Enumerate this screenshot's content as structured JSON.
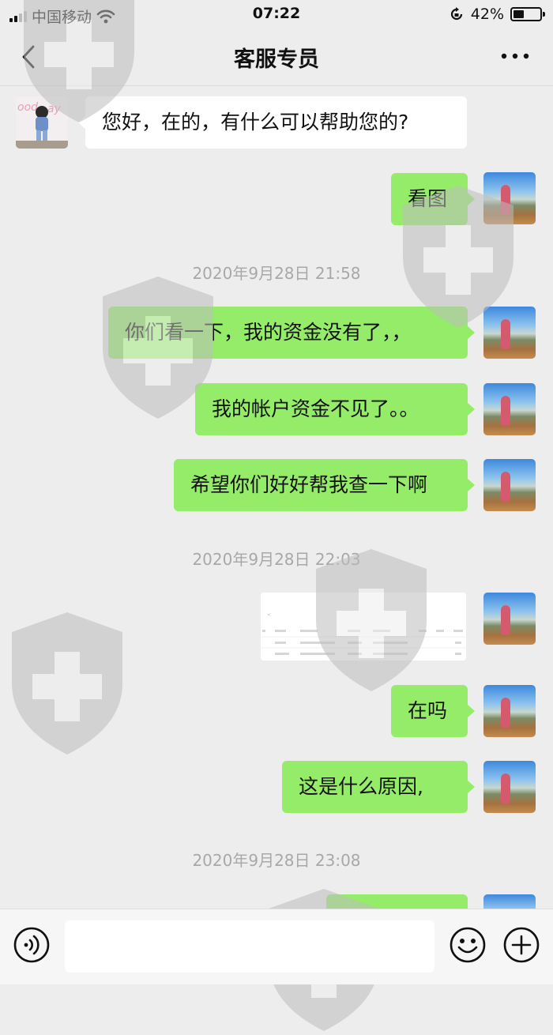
{
  "status_bar": {
    "carrier": "中国移动",
    "time": "07:22",
    "battery_percent": "42%",
    "battery_level": 0.42
  },
  "header": {
    "title": "客服专员"
  },
  "messages": [
    {
      "from": "agent",
      "text": "您好，在的，有什么可以帮助您的?"
    },
    {
      "from": "me",
      "text": "看图"
    },
    {
      "timestamp": "2020年9月28日 21:58"
    },
    {
      "from": "me",
      "text": "你们看一下，我的资金没有了，，"
    },
    {
      "from": "me",
      "text": "我的帐户资金不见了。。"
    },
    {
      "from": "me",
      "text": "希望你们好好帮我查一下啊"
    },
    {
      "timestamp": "2020年9月28日 22:03"
    },
    {
      "from": "me",
      "type": "image"
    },
    {
      "from": "me",
      "text": "在吗"
    },
    {
      "from": "me",
      "text": "这是什么原因,"
    },
    {
      "timestamp": "2020年9月28日 23:08"
    }
  ],
  "icons": {
    "back": "chevron-left-icon",
    "more": "more-dots-icon",
    "voice": "voice-icon",
    "emoji": "emoji-icon",
    "add": "plus-circle-icon"
  },
  "colors": {
    "outgoing_bubble": "#95ec69",
    "incoming_bubble": "#ffffff",
    "background": "#ededed"
  }
}
